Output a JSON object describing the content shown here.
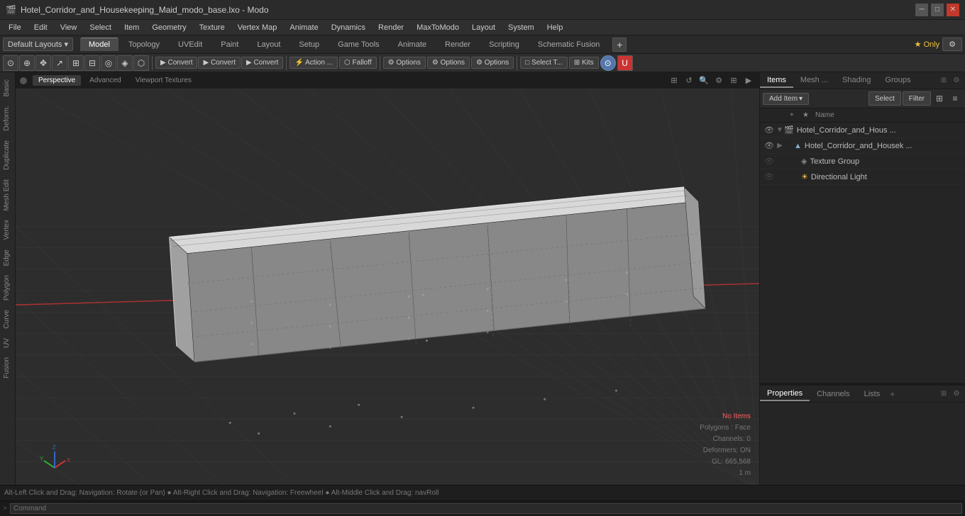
{
  "titlebar": {
    "title": "Hotel_Corridor_and_Housekeeping_Maid_modo_base.lxo - Modo",
    "icon": "🎬"
  },
  "menubar": {
    "items": [
      "File",
      "Edit",
      "View",
      "Select",
      "Item",
      "Geometry",
      "Texture",
      "Vertex Map",
      "Animate",
      "Dynamics",
      "Render",
      "MaxToModo",
      "Layout",
      "System",
      "Help"
    ]
  },
  "layout_bar": {
    "dropdown_label": "Default Layouts ▾",
    "tabs": [
      "Model",
      "Topology",
      "UVEdit",
      "Paint",
      "Layout",
      "Setup",
      "Game Tools",
      "Animate",
      "Render",
      "Scripting",
      "Schematic Fusion"
    ],
    "active_tab": "Model",
    "add_btn": "+",
    "star_only_label": "★ Only",
    "settings_icon": "⚙"
  },
  "toolbar": {
    "icon_btns": [
      "⊙",
      "⊕",
      "⌖",
      "↗",
      "⊞",
      "⊟",
      "◎",
      "◈",
      "⬡"
    ],
    "convert_btns": [
      "Convert",
      "Convert",
      "Convert"
    ],
    "action_label": "Action ...",
    "falloff_label": "Falloff",
    "options_btns": [
      "Options",
      "Options",
      "Options"
    ],
    "select_label": "Select T...",
    "kits_label": "Kits",
    "unity_label": "U"
  },
  "viewport": {
    "tabs": [
      "Perspective",
      "Advanced",
      "Viewport Textures"
    ],
    "active_tab": "Perspective",
    "controls": [
      "⟲",
      "↺",
      "🔍",
      "⚙",
      "⊞",
      "▶"
    ],
    "info": {
      "no_items": "No Items",
      "polygons": "Polygons : Face",
      "channels": "Channels: 0",
      "deformers": "Deformers: ON",
      "gl": "GL: 665,568",
      "scale": "1 m"
    }
  },
  "left_sidebar": {
    "tabs": [
      "Basic",
      "Deform.",
      "Duplicate",
      "Mesh Edit",
      "Vertex",
      "Edge",
      "Polygon",
      "Curve",
      "UV",
      "Fusion"
    ]
  },
  "right_panel": {
    "tabs": [
      "Items",
      "Mesh ...",
      "Shading",
      "Groups"
    ],
    "active_tab": "Items",
    "toolbar": {
      "add_item_label": "Add Item",
      "dropdown_arrow": "▾",
      "select_label": "Select",
      "filter_label": "Filter",
      "icon_plus": "+",
      "icon_star": "★"
    },
    "list_header": {
      "name_col": "Name"
    },
    "items": [
      {
        "id": "root",
        "name": "Hotel_Corridor_and_Hous ...",
        "indent": 0,
        "visible": true,
        "expanded": true,
        "icon": "🎬",
        "selected": false,
        "color": "#4488cc"
      },
      {
        "id": "mesh",
        "name": "Hotel_Corridor_and_Housek ...",
        "indent": 1,
        "visible": true,
        "expanded": false,
        "icon": "▼",
        "selected": false,
        "color": "#88aacc"
      },
      {
        "id": "texture_group",
        "name": "Texture Group",
        "indent": 2,
        "visible": false,
        "expanded": false,
        "icon": "◈",
        "selected": false,
        "color": "#888888"
      },
      {
        "id": "directional_light",
        "name": "Directional Light",
        "indent": 2,
        "visible": false,
        "expanded": false,
        "icon": "☀",
        "selected": false,
        "color": "#ffcc44"
      }
    ]
  },
  "properties_panel": {
    "tabs": [
      "Properties",
      "Channels",
      "Lists"
    ],
    "active_tab": "Properties"
  },
  "statusbar": {
    "hint": "Alt-Left Click and Drag: Navigation: Rotate (or Pan) ● Alt-Right Click and Drag: Navigation: Freewheel ● Alt-Middle Click and Drag: navRoll"
  },
  "command_bar": {
    "prompt": ">",
    "placeholder": "Command"
  }
}
